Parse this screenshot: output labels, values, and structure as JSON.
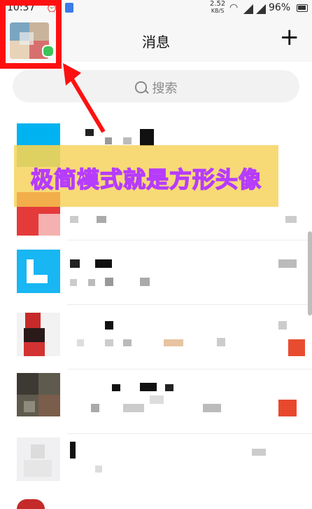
{
  "status_bar": {
    "time": "10:37",
    "speed": "2.52",
    "speed_unit": "KB/S",
    "battery": "96%"
  },
  "header": {
    "title": "消息",
    "add_label": "+"
  },
  "search": {
    "placeholder": "搜索"
  },
  "annotation": {
    "banner_text": "极简模式就是方形头像"
  },
  "colors": {
    "annotation_box": "#ff1010",
    "banner_bg": "#f5d050",
    "banner_text_outline": "#b63cff"
  }
}
